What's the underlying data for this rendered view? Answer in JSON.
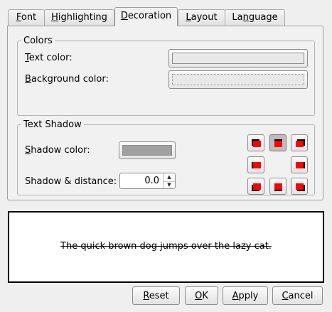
{
  "tabs": [
    {
      "label": "Font"
    },
    {
      "label": "Highlighting"
    },
    {
      "label": "Decoration",
      "active": true
    },
    {
      "label": "Layout"
    },
    {
      "label": "Language"
    }
  ],
  "colors_group": {
    "title": "Colors",
    "text_color_label": "Text color:",
    "background_color_label": "Background color:",
    "text_color_value": "#e9e9e9",
    "background_color_value": "#e9e9e9"
  },
  "shadow_group": {
    "title": "Text Shadow",
    "shadow_color_label": "Shadow color:",
    "shadow_color_value": "#a0a0a0",
    "distance_label": "Shadow & distance:",
    "distance_value": "0.0",
    "selected_direction": "top"
  },
  "preview": {
    "text": "The quick brown dog jumps over the lazy cat."
  },
  "buttons": {
    "reset": "Reset",
    "ok": "OK",
    "apply": "Apply",
    "cancel": "Cancel"
  },
  "icons": {
    "spin_up": "up-arrow-icon",
    "spin_down": "down-arrow-icon",
    "shadow_direction": "shadow-direction-icon"
  },
  "colors": {
    "preview_border": "#000000",
    "shadow_red": "#ff0000"
  }
}
